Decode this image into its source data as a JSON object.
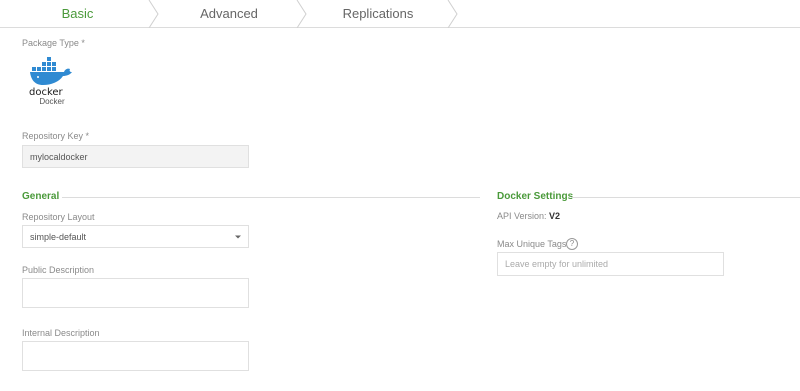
{
  "tabs": [
    {
      "label": "Basic"
    },
    {
      "label": "Advanced"
    },
    {
      "label": "Replications"
    }
  ],
  "package_type": {
    "label": "Package Type *",
    "selected": "Docker",
    "icon_text": "docker",
    "icon": "docker-whale-icon"
  },
  "repository_key": {
    "label": "Repository Key *",
    "value": "mylocaldocker"
  },
  "general": {
    "title": "General",
    "layout_label": "Repository Layout",
    "layout_value": "simple-default",
    "public_desc_label": "Public Description",
    "public_desc_value": "",
    "internal_desc_label": "Internal Description",
    "internal_desc_value": ""
  },
  "docker_settings": {
    "title": "Docker Settings",
    "api_version_label": "API Version:",
    "api_version_value": "V2",
    "max_tags_label": "Max Unique Tags",
    "max_tags_placeholder": "Leave empty for unlimited"
  },
  "colors": {
    "accent": "#4a9a3a",
    "docker_blue": "#2f8ad2"
  }
}
